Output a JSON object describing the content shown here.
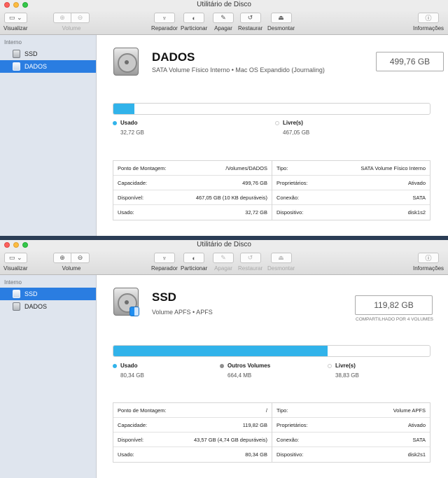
{
  "windows": [
    {
      "title": "Utilitário de Disco",
      "toolbar": {
        "view": "Visualizar",
        "volume": "Volume",
        "repair": "Reparador",
        "partition": "Particionar",
        "erase": "Apagar",
        "restore": "Restaurar",
        "unmount": "Desmontar",
        "info": "Informações"
      },
      "sidebar": {
        "header": "Interno",
        "items": [
          "SSD",
          "DADOS"
        ]
      },
      "volume": {
        "name": "DADOS",
        "description": "SATA Volume Físico Interno • Mac OS Expandido (Journaling)",
        "capacity": "499,76 GB"
      },
      "usage": {
        "used_fraction": 0.066,
        "legend": [
          {
            "label": "Usado",
            "value": "32,72 GB",
            "color": "#31b3ea"
          },
          {
            "label": "Livre(s)",
            "value": "467,05 GB",
            "color": "#ffffff"
          }
        ]
      },
      "info_left": [
        {
          "label": "Ponto de Montagem:",
          "value": "/Volumes/DADOS"
        },
        {
          "label": "Capacidade:",
          "value": "499,76 GB"
        },
        {
          "label": "Disponível:",
          "value": "467,05 GB (10 KB depuráveis)"
        },
        {
          "label": "Usado:",
          "value": "32,72 GB"
        }
      ],
      "info_right": [
        {
          "label": "Tipo:",
          "value": "SATA Volume Físico Interno"
        },
        {
          "label": "Proprietários:",
          "value": "Ativado"
        },
        {
          "label": "Conexão:",
          "value": "SATA"
        },
        {
          "label": "Dispositivo:",
          "value": "disk1s2"
        }
      ]
    },
    {
      "title": "Utilitário de Disco",
      "toolbar": {
        "view": "Visualizar",
        "volume": "Volume",
        "repair": "Reparador",
        "partition": "Particionar",
        "erase": "Apagar",
        "restore": "Restaurar",
        "unmount": "Desmontar",
        "info": "Informações"
      },
      "sidebar": {
        "header": "Interno",
        "items": [
          "SSD",
          "DADOS"
        ]
      },
      "volume": {
        "name": "SSD",
        "description": "Volume APFS • APFS",
        "capacity": "119,82 GB",
        "shared_note": "COMPARTILHADO POR 4 VOLUMES"
      },
      "usage": {
        "used_fraction": 0.676,
        "legend": [
          {
            "label": "Usado",
            "value": "80,34 GB",
            "color": "#31b3ea"
          },
          {
            "label": "Outros Volumes",
            "value": "664,4 MB",
            "color": "#8e8e8e"
          },
          {
            "label": "Livre(s)",
            "value": "38,83 GB",
            "color": "#ffffff"
          }
        ]
      },
      "info_left": [
        {
          "label": "Ponto de Montagem:",
          "value": "/"
        },
        {
          "label": "Capacidade:",
          "value": "119,82 GB"
        },
        {
          "label": "Disponível:",
          "value": "43,57 GB (4,74 GB depuráveis)"
        },
        {
          "label": "Usado:",
          "value": "80,34 GB"
        }
      ],
      "info_right": [
        {
          "label": "Tipo:",
          "value": "Volume APFS"
        },
        {
          "label": "Proprietários:",
          "value": "Ativado"
        },
        {
          "label": "Conexão:",
          "value": "SATA"
        },
        {
          "label": "Dispositivo:",
          "value": "disk2s1"
        }
      ]
    }
  ]
}
